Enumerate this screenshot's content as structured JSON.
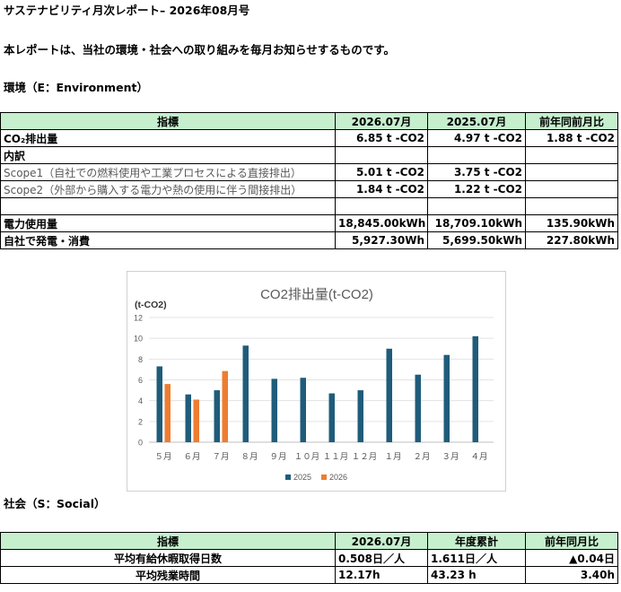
{
  "header": {
    "title": "サステナビリティ月次レポート– 2026年08月号",
    "intro": "本レポートは、当社の環境・社会への取り組みを毎月お知らせするものです。"
  },
  "environment": {
    "heading": "環境（E：Environment）",
    "table": {
      "headers": [
        "指標",
        "2026.07月",
        "2025.07月",
        "前年同前月比"
      ],
      "rows": [
        [
          "CO₂排出量",
          "6.85 t -CO2",
          "4.97 t -CO2",
          "1.88 t -CO2"
        ],
        [
          "内訳",
          "",
          "",
          ""
        ],
        [
          "Scope1（自社での燃料使用や工業プロセスによる直接排出）",
          "5.01 t -CO2",
          "3.75 t -CO2",
          ""
        ],
        [
          "Scope2（外部から購入する電力や熱の使用に伴う間接排出）",
          "1.84 t -CO2",
          "1.22 t -CO2",
          ""
        ],
        [
          "",
          "",
          "",
          ""
        ],
        [
          "電力使用量",
          "18,845.00kWh",
          "18,709.10kWh",
          "135.90kWh"
        ],
        [
          "自社で発電・消費",
          "5,927.30Wh",
          "5,699.50kWh",
          "227.80kWh"
        ]
      ]
    }
  },
  "chart_data": {
    "type": "bar",
    "title": "CO2排出量(t-CO2)",
    "ylabel": "(t-CO2)",
    "categories": [
      "５月",
      "６月",
      "７月",
      "８月",
      "９月",
      "１０月",
      "１１月",
      "１２月",
      "１月",
      "２月",
      "３月",
      "４月"
    ],
    "ylim": [
      0,
      12
    ],
    "yticks": [
      0,
      2,
      4,
      6,
      8,
      10,
      12
    ],
    "grid": true,
    "legend": "bottom",
    "series": [
      {
        "name": "2025",
        "color": "#1f5c7a",
        "values": [
          7.3,
          4.6,
          5.0,
          9.3,
          6.1,
          6.2,
          4.7,
          5.0,
          9.0,
          6.5,
          8.4,
          10.2
        ]
      },
      {
        "name": "2026",
        "color": "#ed7d31",
        "values": [
          5.6,
          4.1,
          6.85,
          null,
          null,
          null,
          null,
          null,
          null,
          null,
          null,
          null
        ]
      }
    ]
  },
  "social": {
    "heading": "社会（S：Social）",
    "table": {
      "headers": [
        "指標",
        "2026.07月",
        "年度累計",
        "前年同月比"
      ],
      "rows": [
        [
          "平均有給休暇取得日数",
          "0.508日／人",
          "1.611日／人",
          "▲0.04日"
        ],
        [
          "平均残業時間",
          "12.17h",
          "43.23 h",
          "3.40h"
        ]
      ]
    }
  }
}
